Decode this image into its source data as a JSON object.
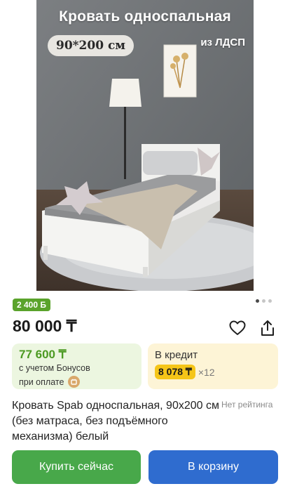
{
  "product_image": {
    "overlay_title": "Кровать односпальная",
    "size_label": "90*200 см",
    "material_label": "из ЛДСП"
  },
  "gallery": {
    "total_images": 3,
    "active_index": 0
  },
  "bonus_badge": "2 400 Б",
  "price": "80 000 ₸",
  "bonus_card": {
    "price": "77 600 ₸",
    "line1": "с учетом Бонусов",
    "line2": "при оплате"
  },
  "credit_card": {
    "label": "В кредит",
    "amount": "8 078 ₸",
    "term": "×12"
  },
  "product_title": "Кровать Spab односпальная, 90х200 см (без матраса, без подъёмного механизма) белый",
  "rating_text": "Нет рейтинга",
  "actions": {
    "buy_label": "Купить сейчас",
    "cart_label": "В корзину"
  },
  "colors": {
    "bonus_green": "#5aa32b",
    "credit_yellow": "#f5c518",
    "buy_button": "#48a84a",
    "cart_button": "#2f6ccf"
  },
  "icons": [
    "heart-icon",
    "share-icon",
    "coin-icon"
  ]
}
